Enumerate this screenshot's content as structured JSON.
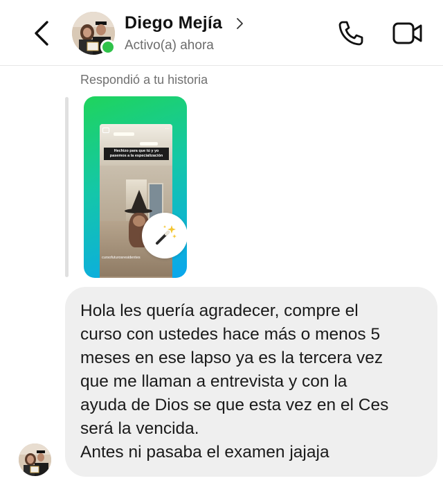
{
  "header": {
    "back_icon": "chevron-left-icon",
    "contact_name": "Diego Mejía",
    "contact_status": "Activo(a) ahora",
    "call_icon": "phone-icon",
    "video_icon": "video-camera-icon",
    "colors": {
      "online": "#2fc24a",
      "status_text": "#6b6b6b"
    }
  },
  "story_reply": {
    "label": "Respondió a tu historia",
    "caption": "Hechizo para que tú y yo pasemos a la especialización",
    "handle": "cursofuturosresidentes",
    "badge_icon": "magic-wand-icon",
    "colors": {
      "gradient_start": "#1fd45c",
      "gradient_end": "#0aa6ee"
    }
  },
  "message": {
    "lines": [
      "Hola les quería agradecer, compre el",
      "curso con ustedes hace más o menos 5",
      "meses en ese lapso ya es la tercera vez",
      "que me llaman a entrevista y con la",
      "ayuda de Dios se que esta vez en el Ces",
      "será la vencida.",
      "Antes ni pasaba el examen jajaja"
    ],
    "bubble_color": "#efefef"
  }
}
